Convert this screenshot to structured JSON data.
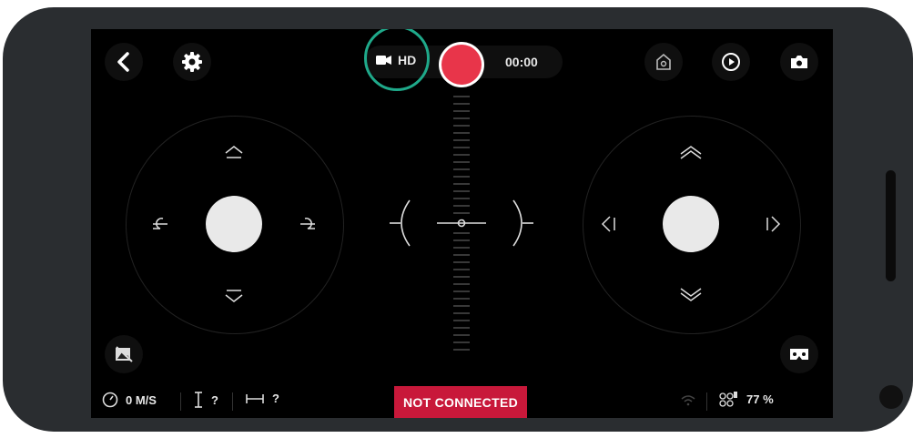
{
  "header": {
    "video_quality": "HD",
    "record_timer": "00:00"
  },
  "status": {
    "connection": "NOT CONNECTED",
    "speed": "0 M/S",
    "altitude": "?",
    "distance": "?",
    "battery": "77 %"
  },
  "icons": {
    "back": "back-icon",
    "settings": "gear-icon",
    "video": "video-camera-icon",
    "home": "home-icon",
    "play": "play-icon",
    "photo": "camera-icon",
    "gallery": "image-off-icon",
    "vr": "vr-headset-icon",
    "speedometer": "speedometer-icon",
    "altitude": "altitude-icon",
    "distance": "distance-icon",
    "wifi": "wifi-icon",
    "drone": "drone-battery-icon"
  },
  "colors": {
    "record": "#e8354a",
    "highlight": "#1fa98a",
    "status_bg": "#c8183a"
  }
}
